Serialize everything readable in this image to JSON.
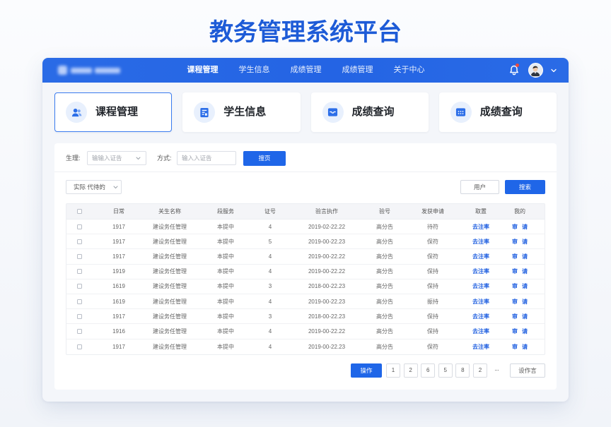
{
  "page_title": "教务管理系统平台",
  "colors": {
    "primary": "#1f66e8",
    "nav": "#2a6be6",
    "title": "#1d5bd7",
    "link": "#1f5fe0",
    "notification_dot": "#f04a3c",
    "card_icon_bg": "#e8f0fd"
  },
  "nav": {
    "items": [
      {
        "label": "课程管理",
        "active": true
      },
      {
        "label": "学生信息",
        "active": false
      },
      {
        "label": "成绩管理",
        "active": false
      },
      {
        "label": "成绩管理",
        "active": false
      },
      {
        "label": "关于中心",
        "active": false
      }
    ],
    "has_notification": true
  },
  "cards": [
    {
      "label": "课程管理",
      "icon": "users-icon",
      "selected": true
    },
    {
      "label": "学生信息",
      "icon": "form-icon",
      "selected": false
    },
    {
      "label": "成绩查询",
      "icon": "inbox-icon",
      "selected": false
    },
    {
      "label": "成绩查询",
      "icon": "grid-icon",
      "selected": false
    }
  ],
  "filters": {
    "field_label": "生理:",
    "field_placeholder": "输输入证告",
    "method_label": "方式:",
    "method_placeholder": "输入入证告",
    "search_button": "搜页"
  },
  "toolbar": {
    "dropdown_value": "实际 代待的",
    "user_button": "用户",
    "search_button": "搜索"
  },
  "table": {
    "columns": [
      "日常",
      "关生名称",
      "段服务",
      "证号",
      "验言执作",
      "验号",
      "发获申请",
      "取置",
      "我的"
    ],
    "rows": [
      {
        "id": "1917",
        "name": "建设务任管理",
        "status": "本提中",
        "cert_no": "4",
        "time": "2019-02-22.22",
        "code": "高分告",
        "apply": "待符",
        "action": "去注率",
        "links": [
          "审",
          "请"
        ]
      },
      {
        "id": "1917",
        "name": "建设务任管理",
        "status": "本提中",
        "cert_no": "5",
        "time": "2019-00-22.23",
        "code": "高分告",
        "apply": "保符",
        "action": "去注率",
        "links": [
          "审",
          "请"
        ]
      },
      {
        "id": "1917",
        "name": "建设务任管理",
        "status": "本提中",
        "cert_no": "4",
        "time": "2019-00-22.22",
        "code": "高分告",
        "apply": "保符",
        "action": "去注率",
        "links": [
          "审",
          "请"
        ]
      },
      {
        "id": "1919",
        "name": "建设务任管理",
        "status": "本提中",
        "cert_no": "4",
        "time": "2019-00-22.22",
        "code": "高分告",
        "apply": "保持",
        "action": "去注率",
        "links": [
          "审",
          "请"
        ]
      },
      {
        "id": "1619",
        "name": "建设务任管理",
        "status": "本提中",
        "cert_no": "3",
        "time": "2018-00-22.23",
        "code": "高分告",
        "apply": "保持",
        "action": "去注率",
        "links": [
          "审",
          "请"
        ]
      },
      {
        "id": "1619",
        "name": "建设务任管理",
        "status": "本提中",
        "cert_no": "4",
        "time": "2019-00-22.23",
        "code": "高分告",
        "apply": "振持",
        "action": "去注率",
        "links": [
          "审",
          "请"
        ]
      },
      {
        "id": "1917",
        "name": "建设务任管理",
        "status": "本提中",
        "cert_no": "3",
        "time": "2018-00-22.23",
        "code": "高分告",
        "apply": "保持",
        "action": "去注率",
        "links": [
          "审",
          "请"
        ]
      },
      {
        "id": "1916",
        "name": "建设务任管理",
        "status": "本提中",
        "cert_no": "4",
        "time": "2019-00-22.22",
        "code": "高分告",
        "apply": "保持",
        "action": "去注率",
        "links": [
          "审",
          "请"
        ]
      },
      {
        "id": "1917",
        "name": "建设务任管理",
        "status": "本提中",
        "cert_no": "4",
        "time": "2019-00-22.23",
        "code": "高分告",
        "apply": "保符",
        "action": "去注率",
        "links": [
          "审",
          "请"
        ]
      }
    ]
  },
  "pagination": {
    "action_button": "操作",
    "pages": [
      "1",
      "2",
      "6",
      "5",
      "8",
      "2"
    ],
    "ellipsis": "···",
    "settings_button": "设作言"
  }
}
